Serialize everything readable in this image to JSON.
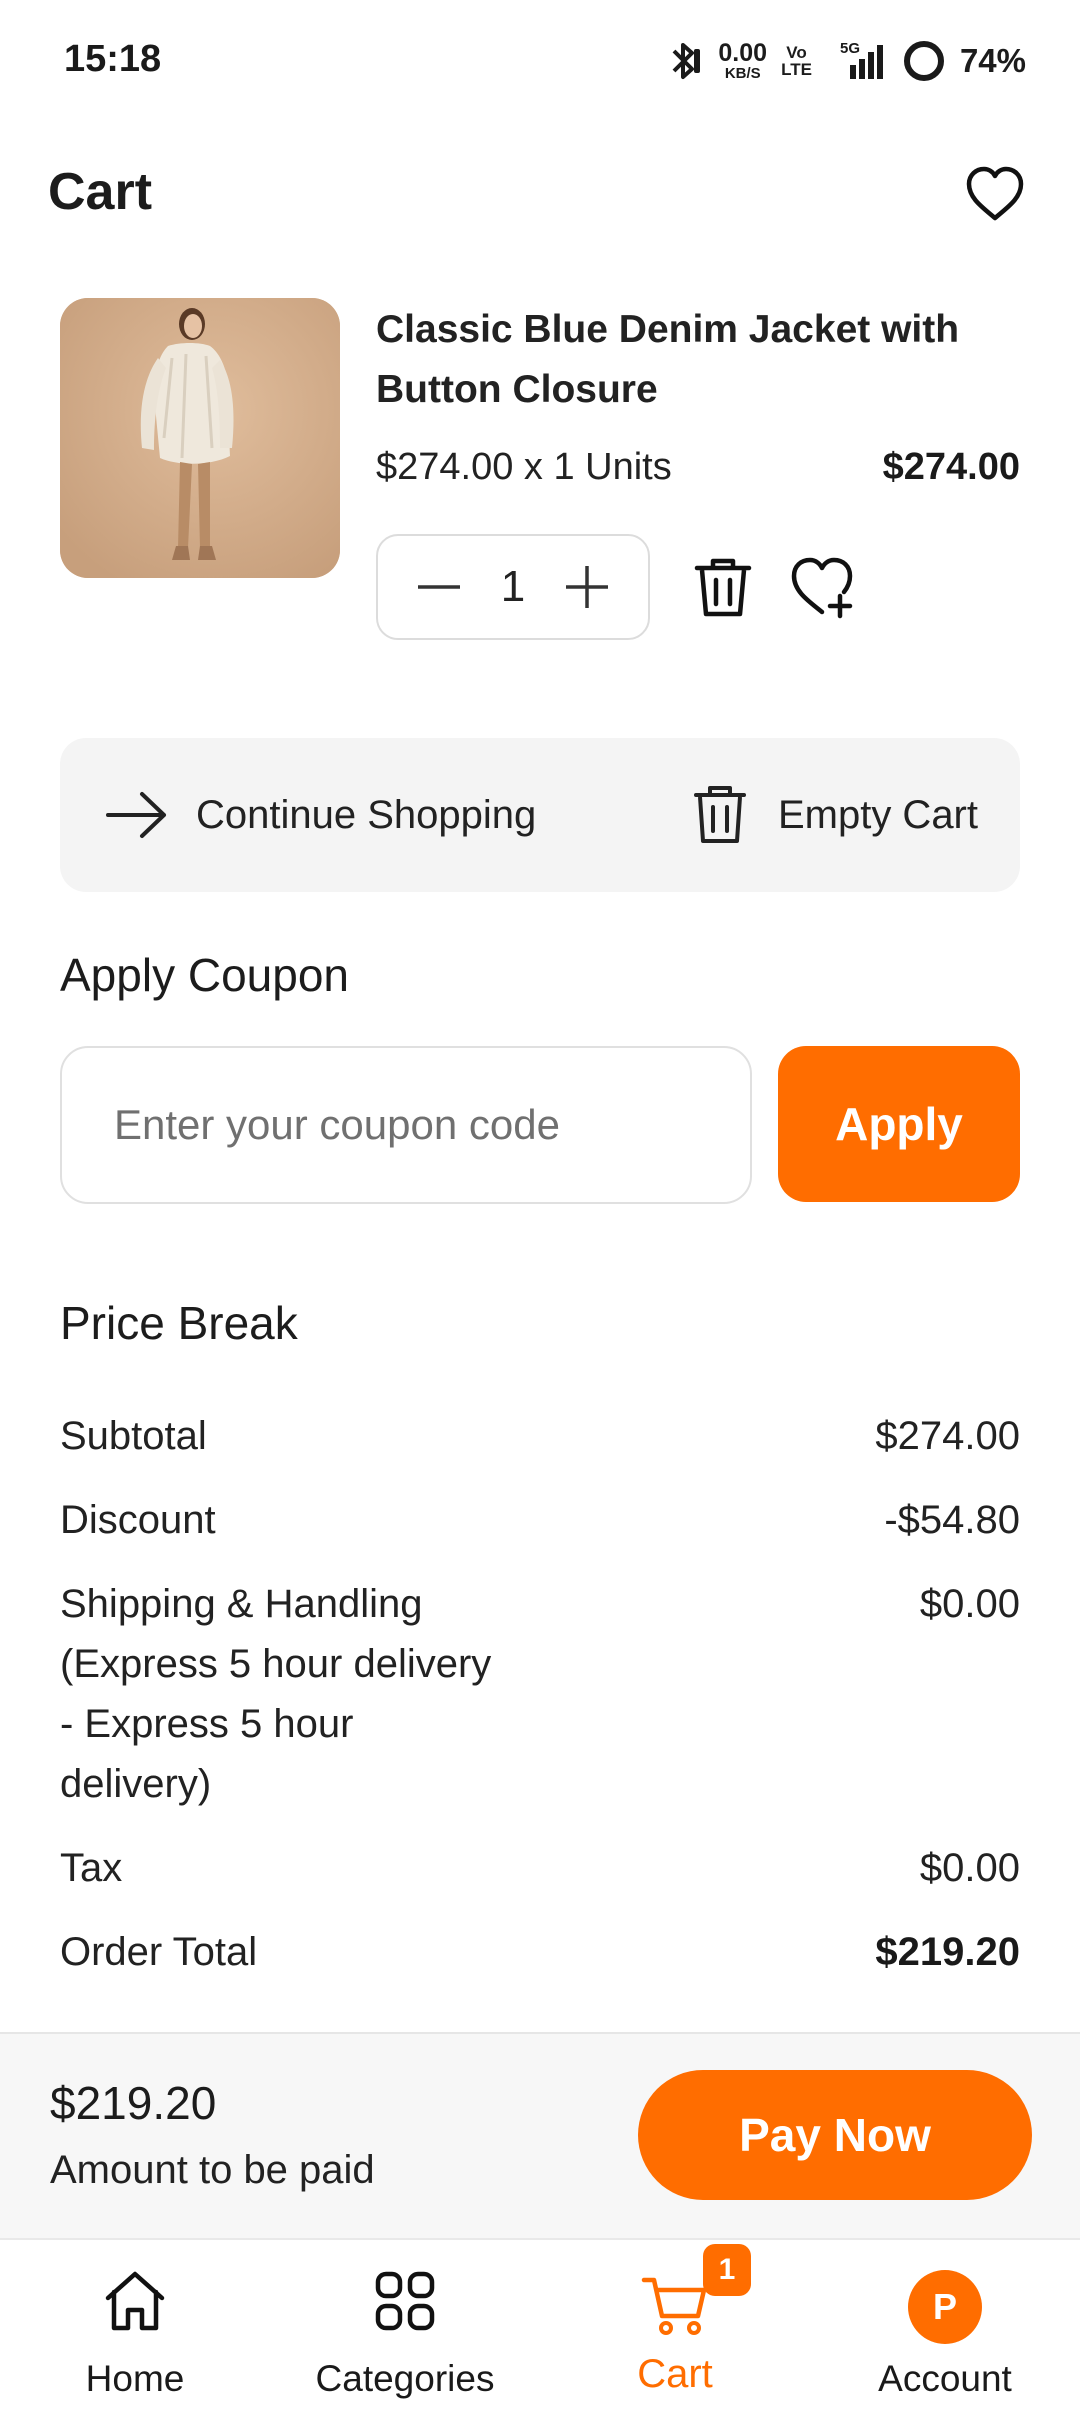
{
  "status_bar": {
    "time": "15:18",
    "net_speed_value": "0.00",
    "net_speed_unit": "KB/S",
    "volte_top": "Vo",
    "volte_bottom": "LTE",
    "network": "5G",
    "battery": "74%"
  },
  "header": {
    "title": "Cart"
  },
  "cart_item": {
    "name": "Classic Blue Denim Jacket with Button Closure",
    "unit_price_text": "$274.00 x 1 Units",
    "line_total": "$274.00",
    "quantity": "1"
  },
  "actions": {
    "continue_label": "Continue Shopping",
    "empty_label": "Empty Cart"
  },
  "coupon": {
    "heading": "Apply Coupon",
    "placeholder": "Enter your coupon code",
    "value": "",
    "apply_label": "Apply"
  },
  "price_break": {
    "heading": "Price Break",
    "rows": [
      {
        "label": "Subtotal",
        "value": "$274.00"
      },
      {
        "label": "Discount",
        "value": "-$54.80"
      },
      {
        "label": "Shipping & Handling (Express 5 hour delivery - Express 5 hour delivery)",
        "value": "$0.00"
      },
      {
        "label": "Tax",
        "value": "$0.00"
      },
      {
        "label": "Order Total",
        "value": "$219.20"
      }
    ]
  },
  "pay_bar": {
    "amount": "$219.20",
    "caption": "Amount to be paid",
    "button_label": "Pay Now"
  },
  "bottom_nav": {
    "items": [
      {
        "label": "Home",
        "icon": "home-icon"
      },
      {
        "label": "Categories",
        "icon": "grid-icon"
      },
      {
        "label": "Cart",
        "icon": "cart-icon",
        "badge": "1",
        "active": true
      },
      {
        "label": "Account",
        "icon": "avatar",
        "avatar_letter": "P"
      }
    ]
  },
  "colors": {
    "accent": "#ff6d00",
    "text": "#1c1c1c",
    "panel": "#f4f4f4"
  }
}
